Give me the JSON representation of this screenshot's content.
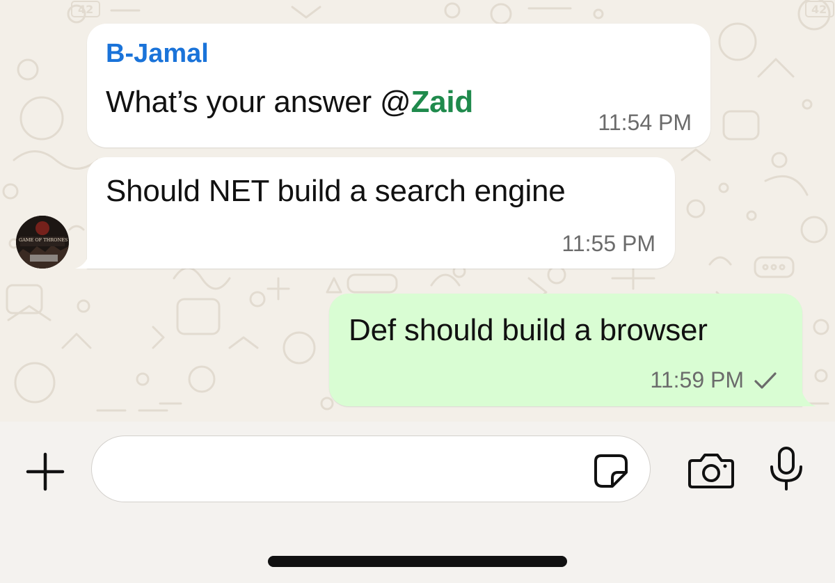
{
  "messages": [
    {
      "direction": "incoming",
      "sender": "B-Jamal",
      "text": "What’s your answer ",
      "mention_at": "@",
      "mention_name": "Zaid",
      "time": "11:54 PM"
    },
    {
      "direction": "incoming",
      "text": "Should NET build a search engine",
      "time": "11:55 PM",
      "avatar_caption": "GAME OF THRONES"
    },
    {
      "direction": "outgoing",
      "text": "Def should build a browser",
      "time": "11:59 PM",
      "status": "sent"
    }
  ],
  "composer": {
    "input_value": "",
    "placeholder": ""
  },
  "icons": {
    "plus": "plus-icon",
    "sticker": "sticker-icon",
    "camera": "camera-icon",
    "mic": "microphone-icon",
    "check": "single-check-icon"
  },
  "colors": {
    "incoming_bubble": "#ffffff",
    "outgoing_bubble": "#d9fdd3",
    "sender_name": "#1a73d9",
    "mention": "#1f8a4c",
    "wallpaper": "#f3efe8"
  }
}
